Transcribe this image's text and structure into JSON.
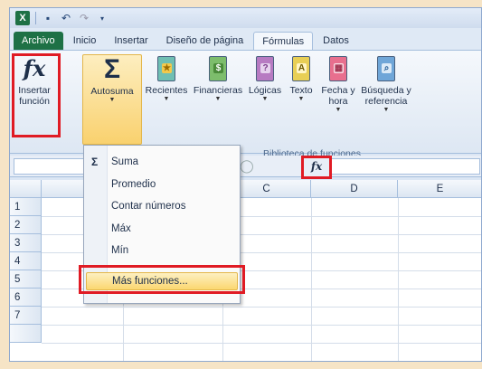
{
  "ribbon": {
    "insert_function_label": "Insertar función",
    "autosum_label": "Autosuma",
    "recent_label": "Recientes",
    "financial_label": "Financieras",
    "logical_label": "Lógicas",
    "text_label": "Texto",
    "datetime_label": "Fecha y hora",
    "lookup_label": "Búsqueda y referencia",
    "group_label": "Biblioteca de funciones",
    "insert_function_glyph": "fx",
    "autosum_glyph": "Σ"
  },
  "tabs": [
    {
      "label": "Archivo"
    },
    {
      "label": "Inicio"
    },
    {
      "label": "Insertar"
    },
    {
      "label": "Diseño de página"
    },
    {
      "label": "Fórmulas"
    },
    {
      "label": "Datos"
    }
  ],
  "active_tab": "Fórmulas",
  "formula_bar": {
    "fx_glyph": "fx"
  },
  "columns": [
    "C",
    "D",
    "E"
  ],
  "rows": [
    "1",
    "2",
    "3",
    "4",
    "5",
    "6",
    "7"
  ],
  "menu": {
    "sigma": "Σ",
    "items": [
      {
        "label": "Suma"
      },
      {
        "label": "Promedio"
      },
      {
        "label": "Contar números"
      },
      {
        "label": "Máx"
      },
      {
        "label": "Mín"
      },
      {
        "label": "Más funciones..."
      }
    ],
    "highlighted": "Más funciones..."
  },
  "colors": {
    "file_tab": "#1e7145",
    "highlight_box": "#e01b24",
    "menu_hover": "#fbd770"
  }
}
